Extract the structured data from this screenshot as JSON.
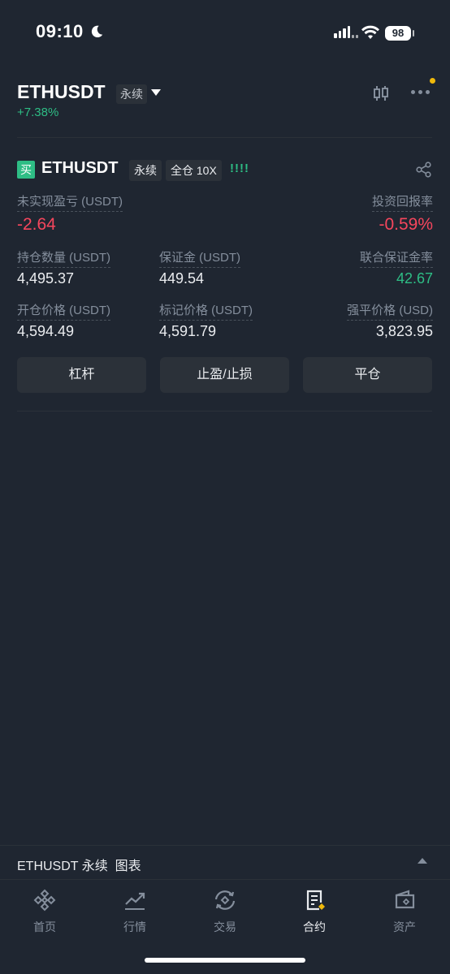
{
  "status_bar": {
    "time": "09:10",
    "battery": "98"
  },
  "header": {
    "symbol": "ETHUSDT",
    "contract_type": "永续",
    "change": "+7.38%"
  },
  "position": {
    "side": "买",
    "symbol": "ETHUSDT",
    "contract_type": "永续",
    "margin_mode": "全仓 10X",
    "risk_indicator": "!!!!",
    "unrealized_pnl_label": "未实现盈亏 (USDT)",
    "unrealized_pnl_value": "-2.64",
    "roi_label": "投资回报率",
    "roi_value": "-0.59%",
    "size_label": "持仓数量 (USDT)",
    "size_value": "4,495.37",
    "margin_label": "保证金 (USDT)",
    "margin_value": "449.54",
    "margin_ratio_label": "联合保证金率",
    "margin_ratio_value": "42.67",
    "entry_price_label": "开仓价格 (USDT)",
    "entry_price_value": "4,594.49",
    "mark_price_label": "标记价格 (USDT)",
    "mark_price_value": "4,591.79",
    "liq_price_label": "强平价格 (USD)",
    "liq_price_value": "3,823.95",
    "buttons": {
      "leverage": "杠杆",
      "tpsl": "止盈/止损",
      "close": "平仓"
    }
  },
  "chart_bar": {
    "label": "ETHUSDT 永续  图表"
  },
  "nav": [
    {
      "label": "首页",
      "icon": "binance-logo-icon"
    },
    {
      "label": "行情",
      "icon": "markets-chart-icon"
    },
    {
      "label": "交易",
      "icon": "trade-exchange-icon"
    },
    {
      "label": "合约",
      "icon": "futures-document-icon",
      "active": true
    },
    {
      "label": "资产",
      "icon": "wallet-icon"
    }
  ],
  "colors": {
    "background": "#1f2631",
    "green": "#2ebd85",
    "red": "#f6465d",
    "accent": "#f0b90b"
  }
}
